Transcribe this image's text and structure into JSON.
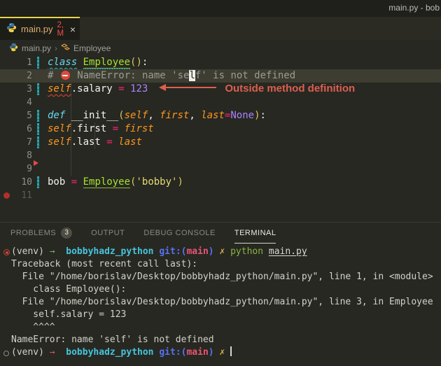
{
  "window": {
    "title": "main.py - bob"
  },
  "colors": {
    "tab_active_border": "#e8d44f",
    "error_red": "#f14c4c",
    "annotation": "#dd5f4f",
    "git_modified_bar": "#2ba5ad"
  },
  "tab": {
    "icon": "python-icon",
    "label": "main.py",
    "badge": "2, M",
    "close": "×"
  },
  "breadcrumb": {
    "file": "main.py",
    "separator": "›",
    "symbol": "Employee"
  },
  "annotation": {
    "text": "Outside method definition"
  },
  "editor": {
    "lines": [
      {
        "num": "1",
        "git": true,
        "tokens": [
          [
            "kw-wavy",
            "class"
          ],
          [
            "plain",
            " "
          ],
          [
            "cls-def-wavy",
            "Employee"
          ],
          [
            "paren",
            "()"
          ],
          [
            "plain",
            ":"
          ]
        ]
      },
      {
        "num": "2",
        "highlight": true,
        "guides": [
          1
        ],
        "tokens": [
          [
            "comment",
            "# "
          ],
          [
            "noentry",
            ""
          ],
          [
            "comment",
            " NameError: name 'se"
          ],
          [
            "cursor",
            "l"
          ],
          [
            "comment",
            "f' is not defined"
          ]
        ]
      },
      {
        "num": "3",
        "git": true,
        "guides": [
          1
        ],
        "annotation": true,
        "tokens": [
          [
            "self-err",
            "self"
          ],
          [
            "plain",
            ".salary"
          ],
          [
            "op",
            " = "
          ],
          [
            "num",
            "123"
          ]
        ]
      },
      {
        "num": "4",
        "guides": [
          1
        ],
        "tokens": []
      },
      {
        "num": "5",
        "git": true,
        "guides": [
          1
        ],
        "tokens": [
          [
            "kw",
            "def"
          ],
          [
            "plain",
            " "
          ],
          [
            "fn",
            "__init__"
          ],
          [
            "paren",
            "("
          ],
          [
            "param",
            "self"
          ],
          [
            "plain",
            ", "
          ],
          [
            "param",
            "first"
          ],
          [
            "plain",
            ", "
          ],
          [
            "param",
            "last"
          ],
          [
            "op",
            "="
          ],
          [
            "const",
            "None"
          ],
          [
            "paren",
            ")"
          ],
          [
            "plain",
            ":"
          ]
        ]
      },
      {
        "num": "6",
        "git": true,
        "guides": [
          1,
          2
        ],
        "tokens": [
          [
            "param",
            "self"
          ],
          [
            "plain",
            ".first"
          ],
          [
            "op",
            " = "
          ],
          [
            "param",
            "first"
          ]
        ]
      },
      {
        "num": "7",
        "git": true,
        "guides": [
          1,
          2
        ],
        "tokens": [
          [
            "param",
            "self"
          ],
          [
            "plain",
            ".last"
          ],
          [
            "op",
            " = "
          ],
          [
            "param",
            "last"
          ]
        ]
      },
      {
        "num": "8",
        "guides": [
          1
        ],
        "marker": "triangle",
        "tokens": []
      },
      {
        "num": "9",
        "guides": [
          1
        ],
        "tokens": []
      },
      {
        "num": "10",
        "git": true,
        "tokens": [
          [
            "plain",
            "bob"
          ],
          [
            "op",
            " = "
          ],
          [
            "cls-ref",
            "Employee"
          ],
          [
            "paren",
            "("
          ],
          [
            "str",
            "'bobby'"
          ],
          [
            "paren",
            ")"
          ]
        ]
      },
      {
        "num": "11",
        "dim": true,
        "marker": "dot",
        "tokens": []
      }
    ]
  },
  "panel": {
    "tabs": [
      {
        "label": "PROBLEMS",
        "badge": "3"
      },
      {
        "label": "OUTPUT"
      },
      {
        "label": "DEBUG CONSOLE"
      },
      {
        "label": "TERMINAL",
        "active": true
      }
    ]
  },
  "terminal": {
    "lines": [
      {
        "tokens": [
          [
            "deco-err",
            ""
          ],
          [
            "tplain",
            "(venv) "
          ],
          [
            "arrow-ok",
            "→"
          ],
          [
            "tplain",
            "  "
          ],
          [
            "host",
            "bobbyhadz_python"
          ],
          [
            "tplain",
            " "
          ],
          [
            "gitblue",
            "git:("
          ],
          [
            "branch",
            "main"
          ],
          [
            "gitblue",
            ")"
          ],
          [
            "tplain",
            " "
          ],
          [
            "cross",
            "✗"
          ],
          [
            "tplain",
            " "
          ],
          [
            "green",
            "python"
          ],
          [
            "tplain",
            " "
          ],
          [
            "underline",
            "main.py"
          ]
        ]
      },
      {
        "tokens": [
          [
            "tplain",
            "Traceback (most recent call last):"
          ]
        ]
      },
      {
        "tokens": [
          [
            "tplain",
            "  File \"/home/borislav/Desktop/bobbyhadz_python/main.py\", line 1, in <module>"
          ]
        ]
      },
      {
        "tokens": [
          [
            "tplain",
            "    class Employee():"
          ]
        ]
      },
      {
        "tokens": [
          [
            "tplain",
            "  File \"/home/borislav/Desktop/bobbyhadz_python/main.py\", line 3, in Employee"
          ]
        ]
      },
      {
        "tokens": [
          [
            "tplain",
            "    self.salary = 123"
          ]
        ]
      },
      {
        "tokens": [
          [
            "tplain",
            "    ^^^^"
          ]
        ]
      },
      {
        "tokens": [
          [
            "tplain",
            "NameError: name 'self' is not defined"
          ]
        ]
      },
      {
        "tokens": [
          [
            "deco-ok",
            ""
          ],
          [
            "tplain",
            "(venv) "
          ],
          [
            "arrow-err",
            "→"
          ],
          [
            "tplain",
            "  "
          ],
          [
            "host",
            "bobbyhadz_python"
          ],
          [
            "tplain",
            " "
          ],
          [
            "gitblue",
            "git:("
          ],
          [
            "branch",
            "main"
          ],
          [
            "gitblue",
            ")"
          ],
          [
            "tplain",
            " "
          ],
          [
            "cross",
            "✗"
          ],
          [
            "tplain",
            " "
          ],
          [
            "cursorbar",
            ""
          ]
        ]
      }
    ]
  }
}
